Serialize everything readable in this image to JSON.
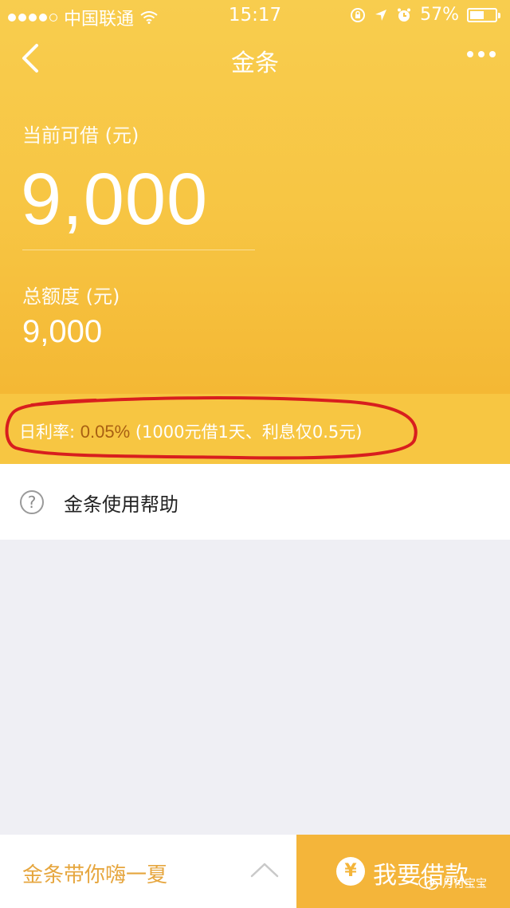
{
  "status_bar": {
    "carrier": "中国联通",
    "time": "15:17",
    "battery": "57%",
    "battery_level": 0.57
  },
  "nav": {
    "title": "金条"
  },
  "credit": {
    "available_label": "当前可借 (元)",
    "available_amount": "9,000",
    "total_label": "总额度 (元)",
    "total_amount": "9,000"
  },
  "rate": {
    "label": "日利率: ",
    "value": "0.05%",
    "note": " (1000元借1天、利息仅0.5元)",
    "circle_color": "#d81e1e"
  },
  "help": {
    "icon": "question-circle-icon",
    "label": "金条使用帮助"
  },
  "bottom": {
    "promo": "金条带你嗨一夏",
    "borrow_icon": "yen-icon",
    "borrow_label": "我要借款",
    "watermark": "月付宝宝"
  },
  "colors": {
    "hero": "#f7c543",
    "accent": "#f4b53a",
    "promo_text": "#e6a63e"
  }
}
